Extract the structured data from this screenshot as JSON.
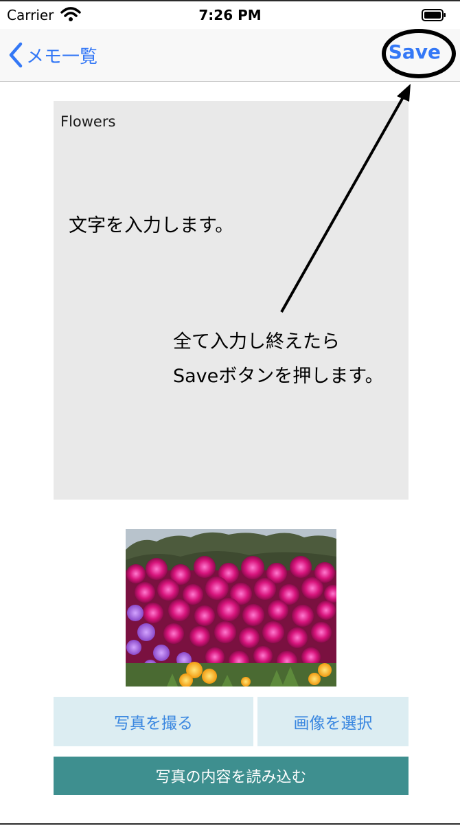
{
  "status_bar": {
    "carrier": "Carrier",
    "time": "7:26 PM"
  },
  "nav": {
    "back_label": "メモ一覧",
    "save_label": "Save"
  },
  "memo": {
    "text": "Flowers"
  },
  "annotations": {
    "input_hint": "文字を入力します。",
    "save_hint_line1": "全て入力し終えたら",
    "save_hint_line2": "Saveボタンを押します。"
  },
  "buttons": {
    "take_photo": "写真を撮る",
    "choose_image": "画像を選択",
    "read_content": "写真の内容を読み込む"
  },
  "colors": {
    "accent": "#3478f6",
    "memo_bg": "#e9e9e9",
    "light_button_bg": "#dcedf2",
    "dark_button_bg": "#3e8f8f"
  },
  "icons": [
    "wifi-icon",
    "battery-icon",
    "chevron-left-icon",
    "arrow-annotation"
  ]
}
